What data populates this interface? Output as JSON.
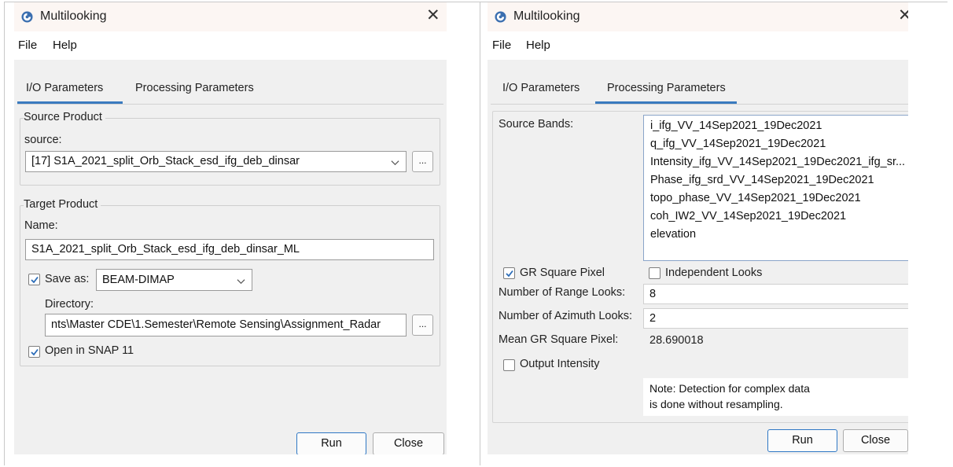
{
  "left_window": {
    "title": "Multilooking",
    "close_glyph": "✕",
    "menu": [
      "File",
      "Help"
    ],
    "tabs": [
      "I/O Parameters",
      "Processing Parameters"
    ],
    "active_tab": "I/O Parameters",
    "source_group": {
      "title": "Source Product",
      "source_label": "source:",
      "source_value": "[17] S1A_2021_split_Orb_Stack_esd_ifg_deb_dinsar",
      "browse_label": "..."
    },
    "target_group": {
      "title": "Target Product",
      "name_label": "Name:",
      "name_value": "S1A_2021_split_Orb_Stack_esd_ifg_deb_dinsar_ML",
      "save_as_label": "Save as:",
      "save_as_checked": true,
      "format_value": "BEAM-DIMAP",
      "directory_label": "Directory:",
      "directory_value": "nts\\Master CDE\\1.Semester\\Remote Sensing\\Assignment_Radar",
      "browse_label": "...",
      "open_in_snap_label": "Open in SNAP 11",
      "open_in_snap_checked": true
    },
    "buttons": {
      "run": "Run",
      "close": "Close"
    }
  },
  "right_window": {
    "title": "Multilooking",
    "close_glyph": "✕",
    "menu": [
      "File",
      "Help"
    ],
    "tabs": [
      "I/O Parameters",
      "Processing Parameters"
    ],
    "active_tab": "Processing Parameters",
    "source_bands_label": "Source Bands:",
    "source_bands": [
      "i_ifg_VV_14Sep2021_19Dec2021",
      "q_ifg_VV_14Sep2021_19Dec2021",
      "Intensity_ifg_VV_14Sep2021_19Dec2021_ifg_sr...",
      "Phase_ifg_srd_VV_14Sep2021_19Dec2021",
      "topo_phase_VV_14Sep2021_19Dec2021",
      "coh_IW2_VV_14Sep2021_19Dec2021",
      "elevation"
    ],
    "gr_square_pixel_label": "GR Square Pixel",
    "gr_square_pixel_checked": true,
    "independent_looks_label": "Independent Looks",
    "independent_looks_checked": false,
    "range_looks_label": "Number of Range Looks:",
    "range_looks_value": "8",
    "azimuth_looks_label": "Number of Azimuth Looks:",
    "azimuth_looks_value": "2",
    "mean_gr_label": "Mean GR Square Pixel:",
    "mean_gr_value": "28.690018",
    "output_intensity_label": "Output Intensity",
    "output_intensity_checked": false,
    "note_lines": [
      "Note: Detection for complex data",
      "is done without resampling."
    ],
    "buttons": {
      "run": "Run",
      "close": "Close"
    }
  },
  "colors": {
    "accent": "#3a7bbf",
    "window_bg": "#f0f0f0",
    "titlebar_bg": "#fcf6f3"
  },
  "icons": [
    "app-icon",
    "close-icon",
    "chevron-down-icon",
    "checkmark-icon"
  ]
}
